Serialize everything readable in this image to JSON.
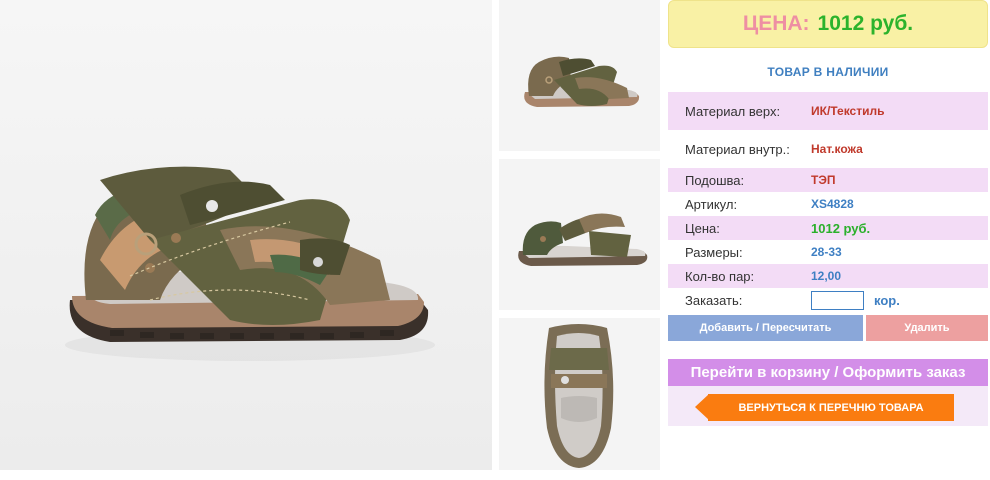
{
  "price": {
    "label": "ЦЕНА:",
    "value": "1012 руб."
  },
  "stock_status": "ТОВАР В НАЛИЧИИ",
  "specs": {
    "upper_material": {
      "label": "Материал верх:",
      "value": "ИК/Текстиль"
    },
    "inner_material": {
      "label": "Материал внутр.:",
      "value": "Нат.кожа"
    },
    "sole": {
      "label": "Подошва:",
      "value": "ТЭП"
    },
    "article": {
      "label": "Артикул:",
      "value": "XS4828"
    },
    "price": {
      "label": "Цена:",
      "value": "1012 руб."
    },
    "sizes": {
      "label": "Размеры:",
      "value": "28-33"
    },
    "pairs": {
      "label": "Кол-во пар:",
      "value": "12,00"
    },
    "order": {
      "label": "Заказать:",
      "unit": "кор.",
      "input_value": ""
    }
  },
  "buttons": {
    "add": "Добавить / Пересчитать",
    "delete": "Удалить",
    "cart": "Перейти в корзину / Оформить заказ",
    "back": "ВЕРНУТЬСЯ К ПЕРЕЧНЮ ТОВАРА"
  },
  "colors": {
    "price_label": "#ee8fa3",
    "price_value": "#2cb32c",
    "accent_blue": "#3e7fc3",
    "back_orange": "#fa7c10",
    "cart_purple": "#d38ee8"
  }
}
